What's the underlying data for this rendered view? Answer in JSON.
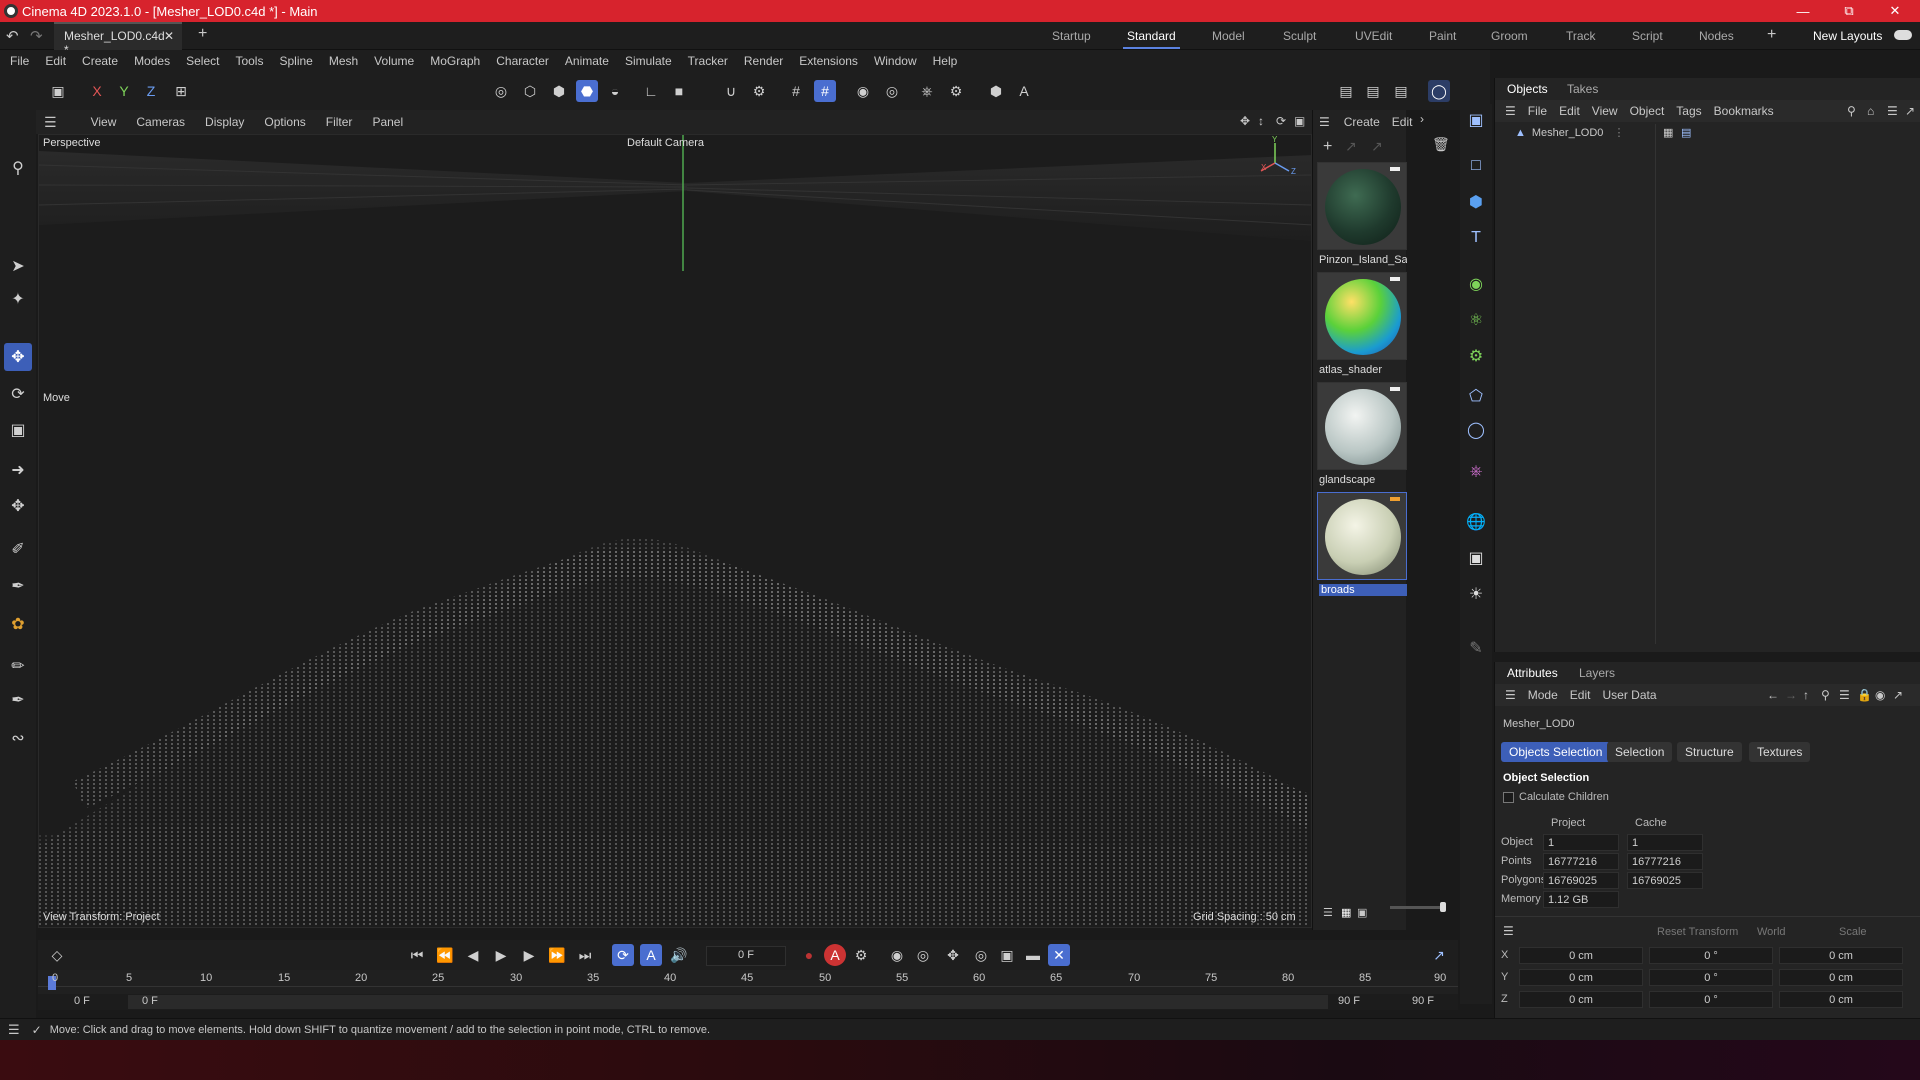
{
  "window": {
    "title": "Cinema 4D 2023.1.0 - [Mesher_LOD0.c4d *] - Main"
  },
  "doc_tab": {
    "name": "Mesher_LOD0.c4d *"
  },
  "layouts": [
    "Startup",
    "Standard",
    "Model",
    "Sculpt",
    "UVEdit",
    "Paint",
    "Groom",
    "Track",
    "Script",
    "Nodes"
  ],
  "active_layout": "Standard",
  "new_layouts_label": "New Layouts",
  "menu": [
    "File",
    "Edit",
    "Create",
    "Modes",
    "Select",
    "Tools",
    "Spline",
    "Mesh",
    "Volume",
    "MoGraph",
    "Character",
    "Animate",
    "Simulate",
    "Tracker",
    "Render",
    "Extensions",
    "Window",
    "Help"
  ],
  "axes": [
    "X",
    "Y",
    "Z"
  ],
  "viewport": {
    "menu": [
      "View",
      "Cameras",
      "Display",
      "Options",
      "Filter",
      "Panel"
    ],
    "projection": "Perspective",
    "camera": "Default Camera",
    "tool_label": "Move",
    "view_transform": "View Transform: Project",
    "grid_spacing": "Grid Spacing : 50 cm"
  },
  "materials": {
    "menu": [
      "Create",
      "Edit"
    ],
    "items": [
      {
        "name": "Pinzon_Island_Sat",
        "gradient": "radial-gradient(circle at 40% 35%,#3f6b52,#1f3a2d 55%,#0e1d16)",
        "flag": "#eeeeee"
      },
      {
        "name": "atlas_shader",
        "gradient": "radial-gradient(circle at 35% 30%,#ffe066,#5bd13a 40%,#1a9bd1 70%,#2245a8)",
        "flag": "#eeeeee"
      },
      {
        "name": "glandscape",
        "gradient": "radial-gradient(circle at 40% 35%,#f2f4f2,#b9c6c4 55%,#6f8282)",
        "flag": "#eeeeee"
      },
      {
        "name": "broads",
        "gradient": "radial-gradient(circle at 40% 35%,#f4f4e6,#c9cfb4 55%,#79826a)",
        "flag": "#f0a030"
      }
    ]
  },
  "objects_panel": {
    "tabs": [
      "Objects",
      "Takes"
    ],
    "menu": [
      "File",
      "Edit",
      "View",
      "Object",
      "Tags",
      "Bookmarks"
    ],
    "object": "Mesher_LOD0"
  },
  "attributes": {
    "tabs": [
      "Attributes",
      "Layers"
    ],
    "menu": [
      "Mode",
      "Edit",
      "User Data"
    ],
    "object_name": "Mesher_LOD0",
    "subtabs": [
      "Objects Selection",
      "Selection",
      "Structure",
      "Textures"
    ],
    "section": "Object Selection",
    "checkbox_label": "Calculate Children",
    "col_project": "Project",
    "col_cache": "Cache",
    "rows": [
      {
        "label": "Object",
        "project": "1",
        "cache": "1"
      },
      {
        "label": "Points",
        "project": "16777216",
        "cache": "16777216"
      },
      {
        "label": "Polygons",
        "project": "16769025",
        "cache": "16769025"
      },
      {
        "label": "Memory",
        "project": "1.12 GB",
        "cache": ""
      }
    ],
    "transform": {
      "reset": "Reset Transform",
      "space": "World",
      "mode": "Scale",
      "rows": [
        {
          "axis": "X",
          "pos": "0 cm",
          "rot": "0 °",
          "scale": "0 cm"
        },
        {
          "axis": "Y",
          "pos": "0 cm",
          "rot": "0 °",
          "scale": "0 cm"
        },
        {
          "axis": "Z",
          "pos": "0 cm",
          "rot": "0 °",
          "scale": "0 cm"
        }
      ]
    }
  },
  "timeline": {
    "current_frame": "0 F",
    "ticks": [
      "0",
      "5",
      "10",
      "15",
      "20",
      "25",
      "30",
      "35",
      "40",
      "45",
      "50",
      "55",
      "60",
      "65",
      "70",
      "75",
      "80",
      "85",
      "90"
    ],
    "start": "0 F",
    "range_start": "0 F",
    "range_end": "90 F",
    "end": "90 F"
  },
  "status": "Move: Click and drag to move elements. Hold down SHIFT to quantize movement / add to the selection in point mode, CTRL to remove."
}
